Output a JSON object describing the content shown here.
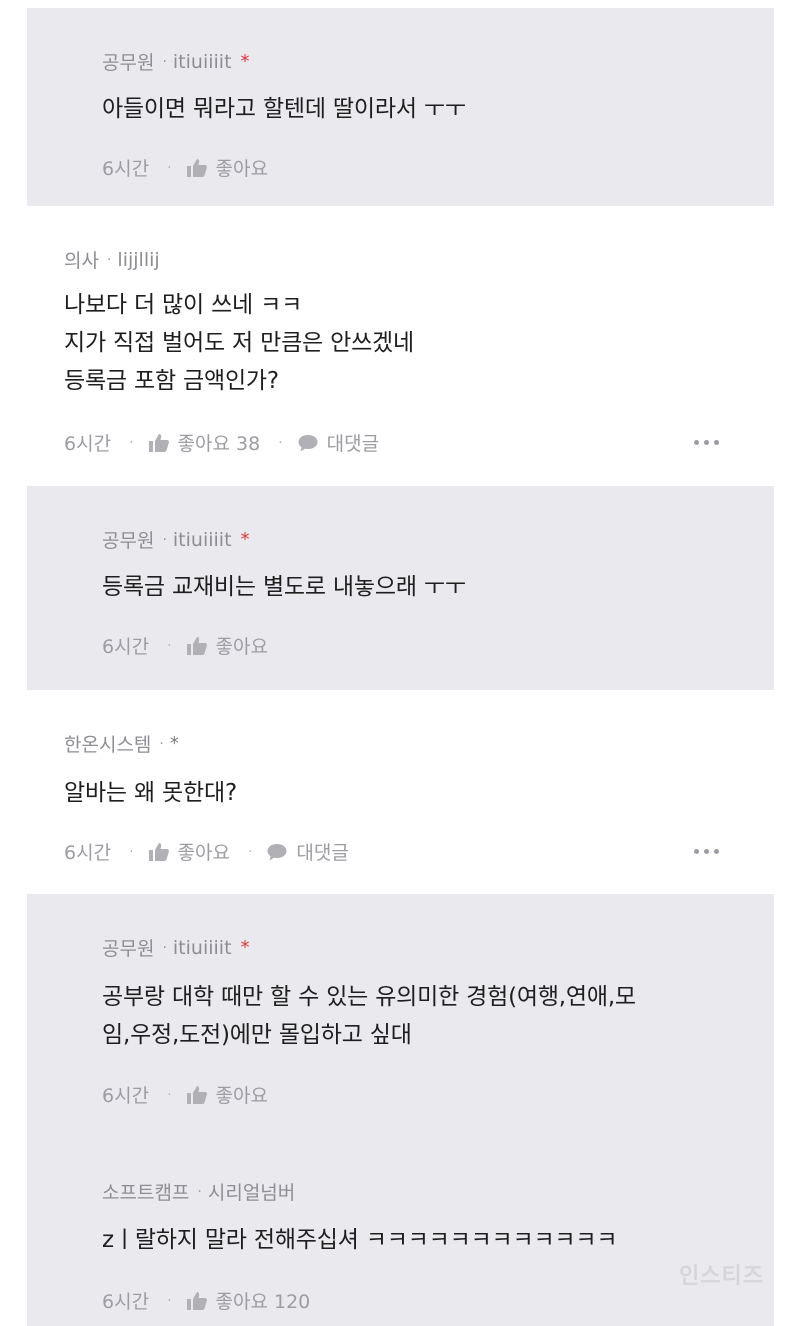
{
  "comments": [
    {
      "kind": "reply",
      "job": "공무원",
      "user": "itiuiiiit",
      "marker": "*",
      "lines": [
        "아들이면 뭐라고 할텐데 딸이라서  ㅜㅜ"
      ],
      "time": "6시간",
      "like_label": "좋아요"
    },
    {
      "kind": "comment",
      "job": "의사",
      "user": "lijjllij",
      "marker": "",
      "lines": [
        "나보다 더 많이 쓰네 ㅋㅋ",
        "지가 직접 벌어도 저 만큼은 안쓰겠네",
        "등록금 포함 금액인가?"
      ],
      "time": "6시간",
      "like_label": "좋아요 38",
      "reply_label": "대댓글"
    },
    {
      "kind": "reply",
      "job": "공무원",
      "user": "itiuiiiit",
      "marker": "*",
      "lines": [
        "등록금 교재비는 별도로 내놓으래  ㅜㅜ"
      ],
      "time": "6시간",
      "like_label": "좋아요"
    },
    {
      "kind": "comment",
      "job": "한온시스템",
      "user": "",
      "marker": "*",
      "lines": [
        "알바는 왜 못한대?"
      ],
      "time": "6시간",
      "like_label": "좋아요",
      "reply_label": "대댓글"
    },
    {
      "kind": "reply",
      "job": "공무원",
      "user": "itiuiiiit",
      "marker": "*",
      "lines": [
        "공부랑 대학 때만 할 수 있는 유의미한 경험(여행,연애,모",
        "임,우정,도전)에만 몰입하고 싶대"
      ],
      "time": "6시간",
      "like_label": "좋아요"
    },
    {
      "kind": "reply",
      "job": "소프트캠프",
      "user": "시리얼넘버",
      "marker": "",
      "lines": [
        "zㅣ랄하지 말라 전해주십셔 ㅋㅋㅋㅋㅋㅋㅋㅋㅋㅋㅋㅋ"
      ],
      "time": "6시간",
      "like_label": "좋아요 120"
    }
  ],
  "watermark": "인스티즈",
  "colors": {
    "reply_bg": "#eaeaee",
    "marker_red": "#e0323b",
    "meta_gray": "#9c9ca2"
  }
}
